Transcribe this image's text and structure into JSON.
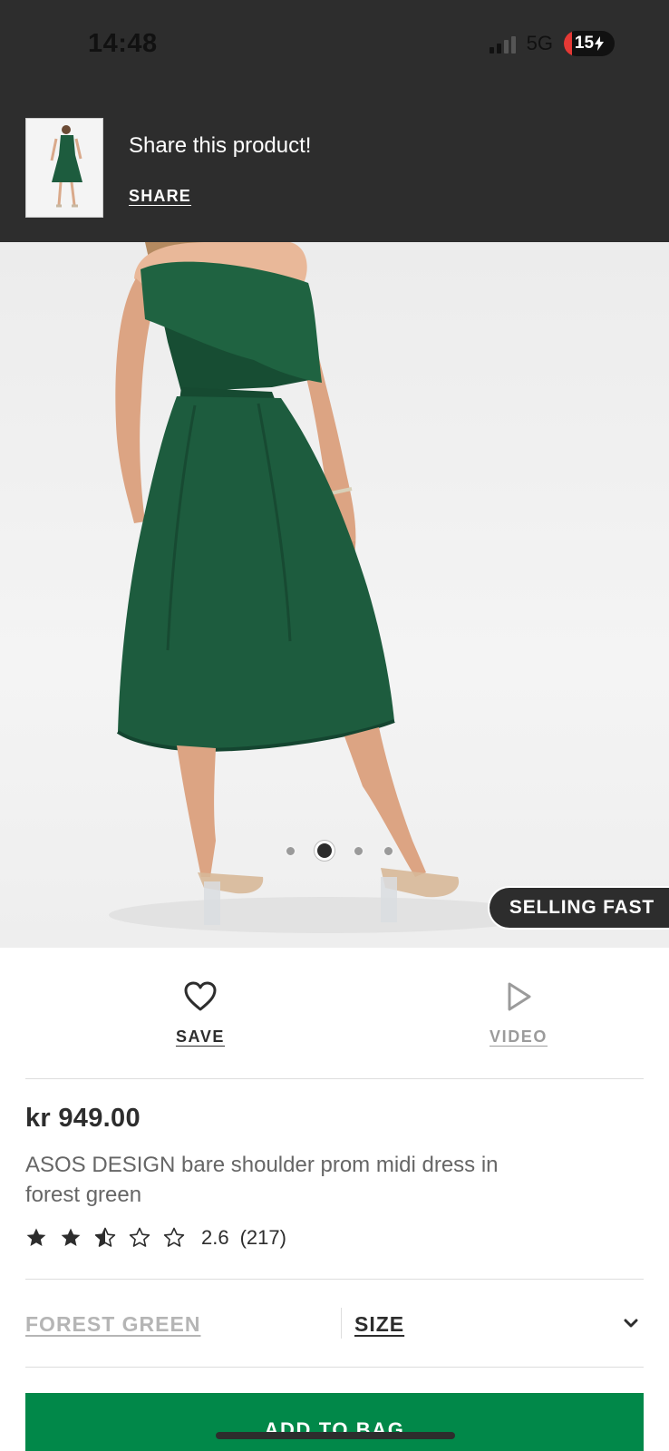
{
  "status_bar": {
    "time": "14:48",
    "network": "5G",
    "battery": "15",
    "battery_icon": "charging-bolt-icon"
  },
  "share_banner": {
    "title": "Share this product!",
    "link_label": "SHARE"
  },
  "gallery": {
    "image_count": 4,
    "active_index": 1,
    "badge": "SELLING FAST"
  },
  "actions": {
    "save_label": "SAVE",
    "save_icon": "heart-icon",
    "video_label": "VIDEO",
    "video_icon": "play-icon"
  },
  "product": {
    "price": "kr 949.00",
    "title": "ASOS DESIGN bare shoulder prom midi dress in forest green",
    "rating_value": "2.6",
    "rating_stars": 2.6,
    "rating_count": "(217)"
  },
  "selectors": {
    "colour_label": "FOREST GREEN",
    "size_label": "SIZE"
  },
  "cta": {
    "add_to_bag_label": "ADD TO BAG"
  },
  "colors": {
    "dark_bg": "#2d2d2d",
    "dress_green": "#1d5c3e",
    "cta_green": "#018849",
    "muted_text": "#666666",
    "disabled_text": "#9b9b9b"
  }
}
